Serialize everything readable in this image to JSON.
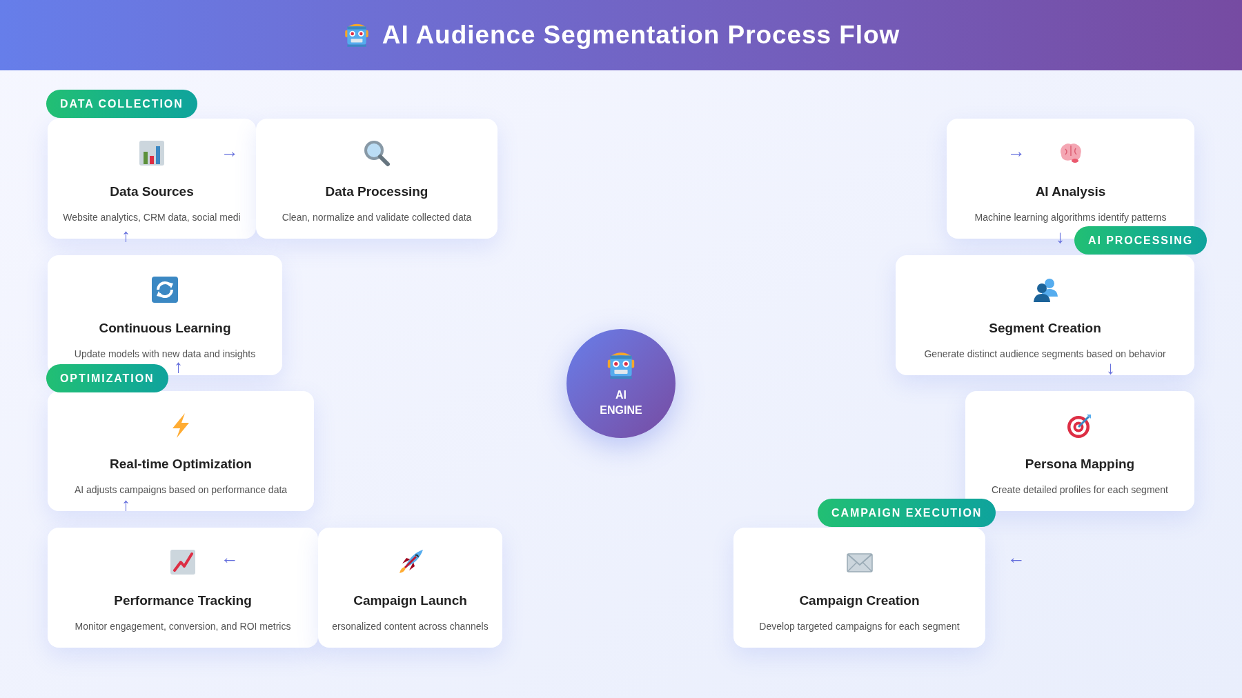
{
  "header": {
    "title": "AI Audience Segmentation Process Flow"
  },
  "phases": [
    {
      "label": "DATA COLLECTION"
    },
    {
      "label": "AI PROCESSING"
    },
    {
      "label": "CAMPAIGN EXECUTION"
    },
    {
      "label": "OPTIMIZATION"
    }
  ],
  "steps": [
    {
      "title": "Data Sources",
      "description": "Website analytics, CRM data, social medi"
    },
    {
      "title": "Data Processing",
      "description": "Clean, normalize and validate collected data"
    },
    {
      "title": "AI Analysis",
      "description": "Machine learning algorithms identify patterns"
    },
    {
      "title": "Continuous Learning",
      "description": "Update models with new data and insights"
    },
    {
      "title": "Segment Creation",
      "description": "Generate distinct audience segments based on behavior"
    },
    {
      "title": "Real-time Optimization",
      "description": "AI adjusts campaigns based on performance data"
    },
    {
      "title": "Persona Mapping",
      "description": "Create detailed profiles for each segment"
    },
    {
      "title": "Performance Tracking",
      "description": "Monitor engagement, conversion, and ROI metrics"
    },
    {
      "title": "Campaign Launch",
      "description": "ersonalized content across channels"
    },
    {
      "title": "Campaign Creation",
      "description": "Develop targeted campaigns for each segment"
    }
  ],
  "arrows": [
    "→",
    "→",
    "↑",
    "↓",
    "↑",
    "↓",
    "↑",
    "←",
    "←"
  ],
  "engine": {
    "label": "AI ENGINE"
  }
}
